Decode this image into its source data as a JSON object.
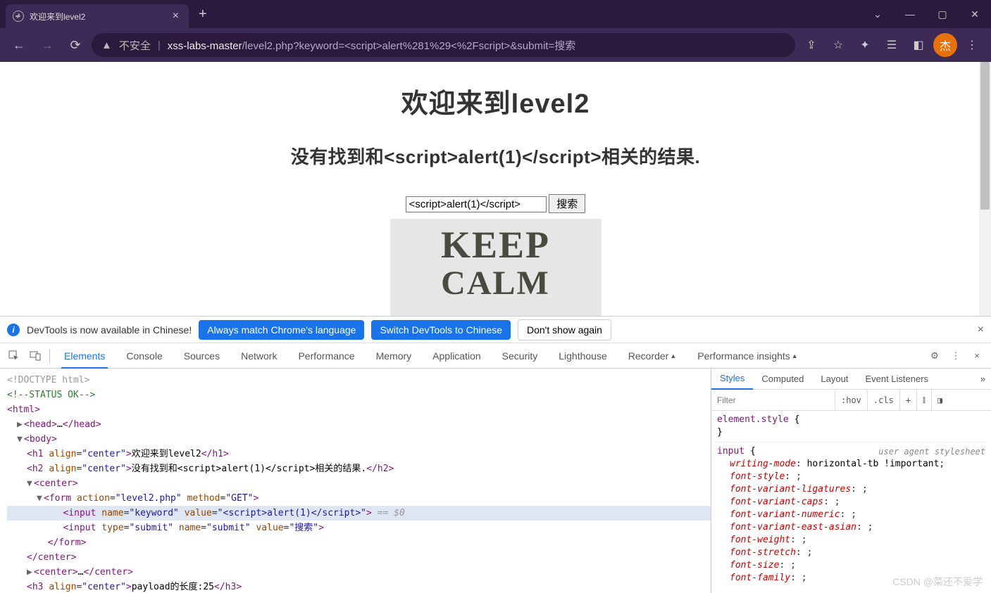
{
  "browser": {
    "tab_title": "欢迎来到level2",
    "url_insecure_label": "不安全",
    "url_host": "xss-labs-master",
    "url_path": "/level2.php?keyword=<script>alert%281%29<%2Fscript>&submit=搜索",
    "avatar_letter": "杰"
  },
  "page": {
    "h1": "欢迎来到level2",
    "h2": "没有找到和<script>alert(1)</script>相关的结果.",
    "input_value": "<script>alert(1)</script>",
    "submit_label": "搜索",
    "poster_line1": "KEEP",
    "poster_line2": "CALM"
  },
  "devtools": {
    "infobar_msg": "DevTools is now available in Chinese!",
    "btn_always": "Always match Chrome's language",
    "btn_switch": "Switch DevTools to Chinese",
    "btn_dont": "Don't show again",
    "tabs": [
      "Elements",
      "Console",
      "Sources",
      "Network",
      "Performance",
      "Memory",
      "Application",
      "Security",
      "Lighthouse",
      "Recorder",
      "Performance insights"
    ],
    "styles_tabs": [
      "Styles",
      "Computed",
      "Layout",
      "Event Listeners"
    ],
    "filter_placeholder": "Filter",
    "filter_btns": [
      ":hov",
      ".cls",
      "+"
    ],
    "dom": {
      "doctype": "<!DOCTYPE html>",
      "comment": "<!--STATUS OK-->",
      "h1_text": "欢迎来到level2",
      "h2_text_pre": "没有找到和",
      "h2_text_mid": "<script>alert(1)</script>",
      "h2_text_post": "相关的结果.",
      "form_action": "level2.php",
      "form_method": "GET",
      "input_name": "keyword",
      "input_value": "<script>alert(1)</script>",
      "submit_name": "submit",
      "submit_value": "搜索",
      "sel_hint": "== $0",
      "h3_text": "payload的长度:25"
    },
    "styles": {
      "elstyle_sel": "element.style",
      "input_sel": "input",
      "ua_label": "user agent stylesheet",
      "props": [
        {
          "k": "writing-mode",
          "v": "horizontal-tb !important"
        },
        {
          "k": "font-style",
          "v": ""
        },
        {
          "k": "font-variant-ligatures",
          "v": ""
        },
        {
          "k": "font-variant-caps",
          "v": ""
        },
        {
          "k": "font-variant-numeric",
          "v": ""
        },
        {
          "k": "font-variant-east-asian",
          "v": ""
        },
        {
          "k": "font-weight",
          "v": ""
        },
        {
          "k": "font-stretch",
          "v": ""
        },
        {
          "k": "font-size",
          "v": ""
        },
        {
          "k": "font-family",
          "v": ""
        }
      ]
    }
  },
  "watermark": "CSDN @菜还不爱学"
}
